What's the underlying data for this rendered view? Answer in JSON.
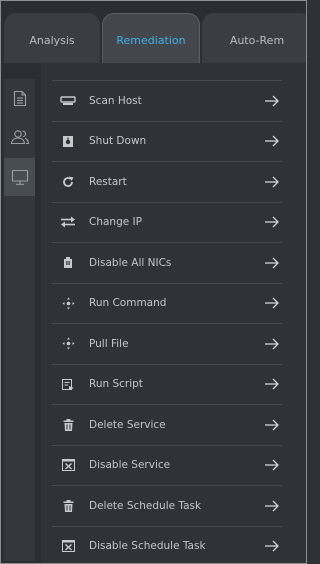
{
  "tabs": [
    {
      "label": "Analysis",
      "active": false
    },
    {
      "label": "Remediation",
      "active": true
    },
    {
      "label": "Auto-Rem",
      "active": false
    }
  ],
  "rail": [
    {
      "icon": "document-icon",
      "active": false
    },
    {
      "icon": "users-icon",
      "active": false
    },
    {
      "icon": "monitor-icon",
      "active": true
    }
  ],
  "actions": [
    {
      "label": "Scan Host",
      "icon": "scan-host-icon"
    },
    {
      "label": "Shut Down",
      "icon": "shut-down-icon"
    },
    {
      "label": "Restart",
      "icon": "restart-icon"
    },
    {
      "label": "Change IP",
      "icon": "change-ip-icon"
    },
    {
      "label": "Disable All NICs",
      "icon": "disable-nics-icon"
    },
    {
      "label": "Run Command",
      "icon": "run-command-icon"
    },
    {
      "label": "Pull File",
      "icon": "pull-file-icon"
    },
    {
      "label": "Run Script",
      "icon": "run-script-icon"
    },
    {
      "label": "Delete Service",
      "icon": "trash-icon"
    },
    {
      "label": "Disable Service",
      "icon": "disable-service-icon"
    },
    {
      "label": "Delete Schedule Task",
      "icon": "trash-icon"
    },
    {
      "label": "Disable Schedule Task",
      "icon": "disable-task-icon"
    }
  ],
  "colors": {
    "accent": "#3fb0e8",
    "background": "#2e3236",
    "text": "#c3c7cb"
  }
}
